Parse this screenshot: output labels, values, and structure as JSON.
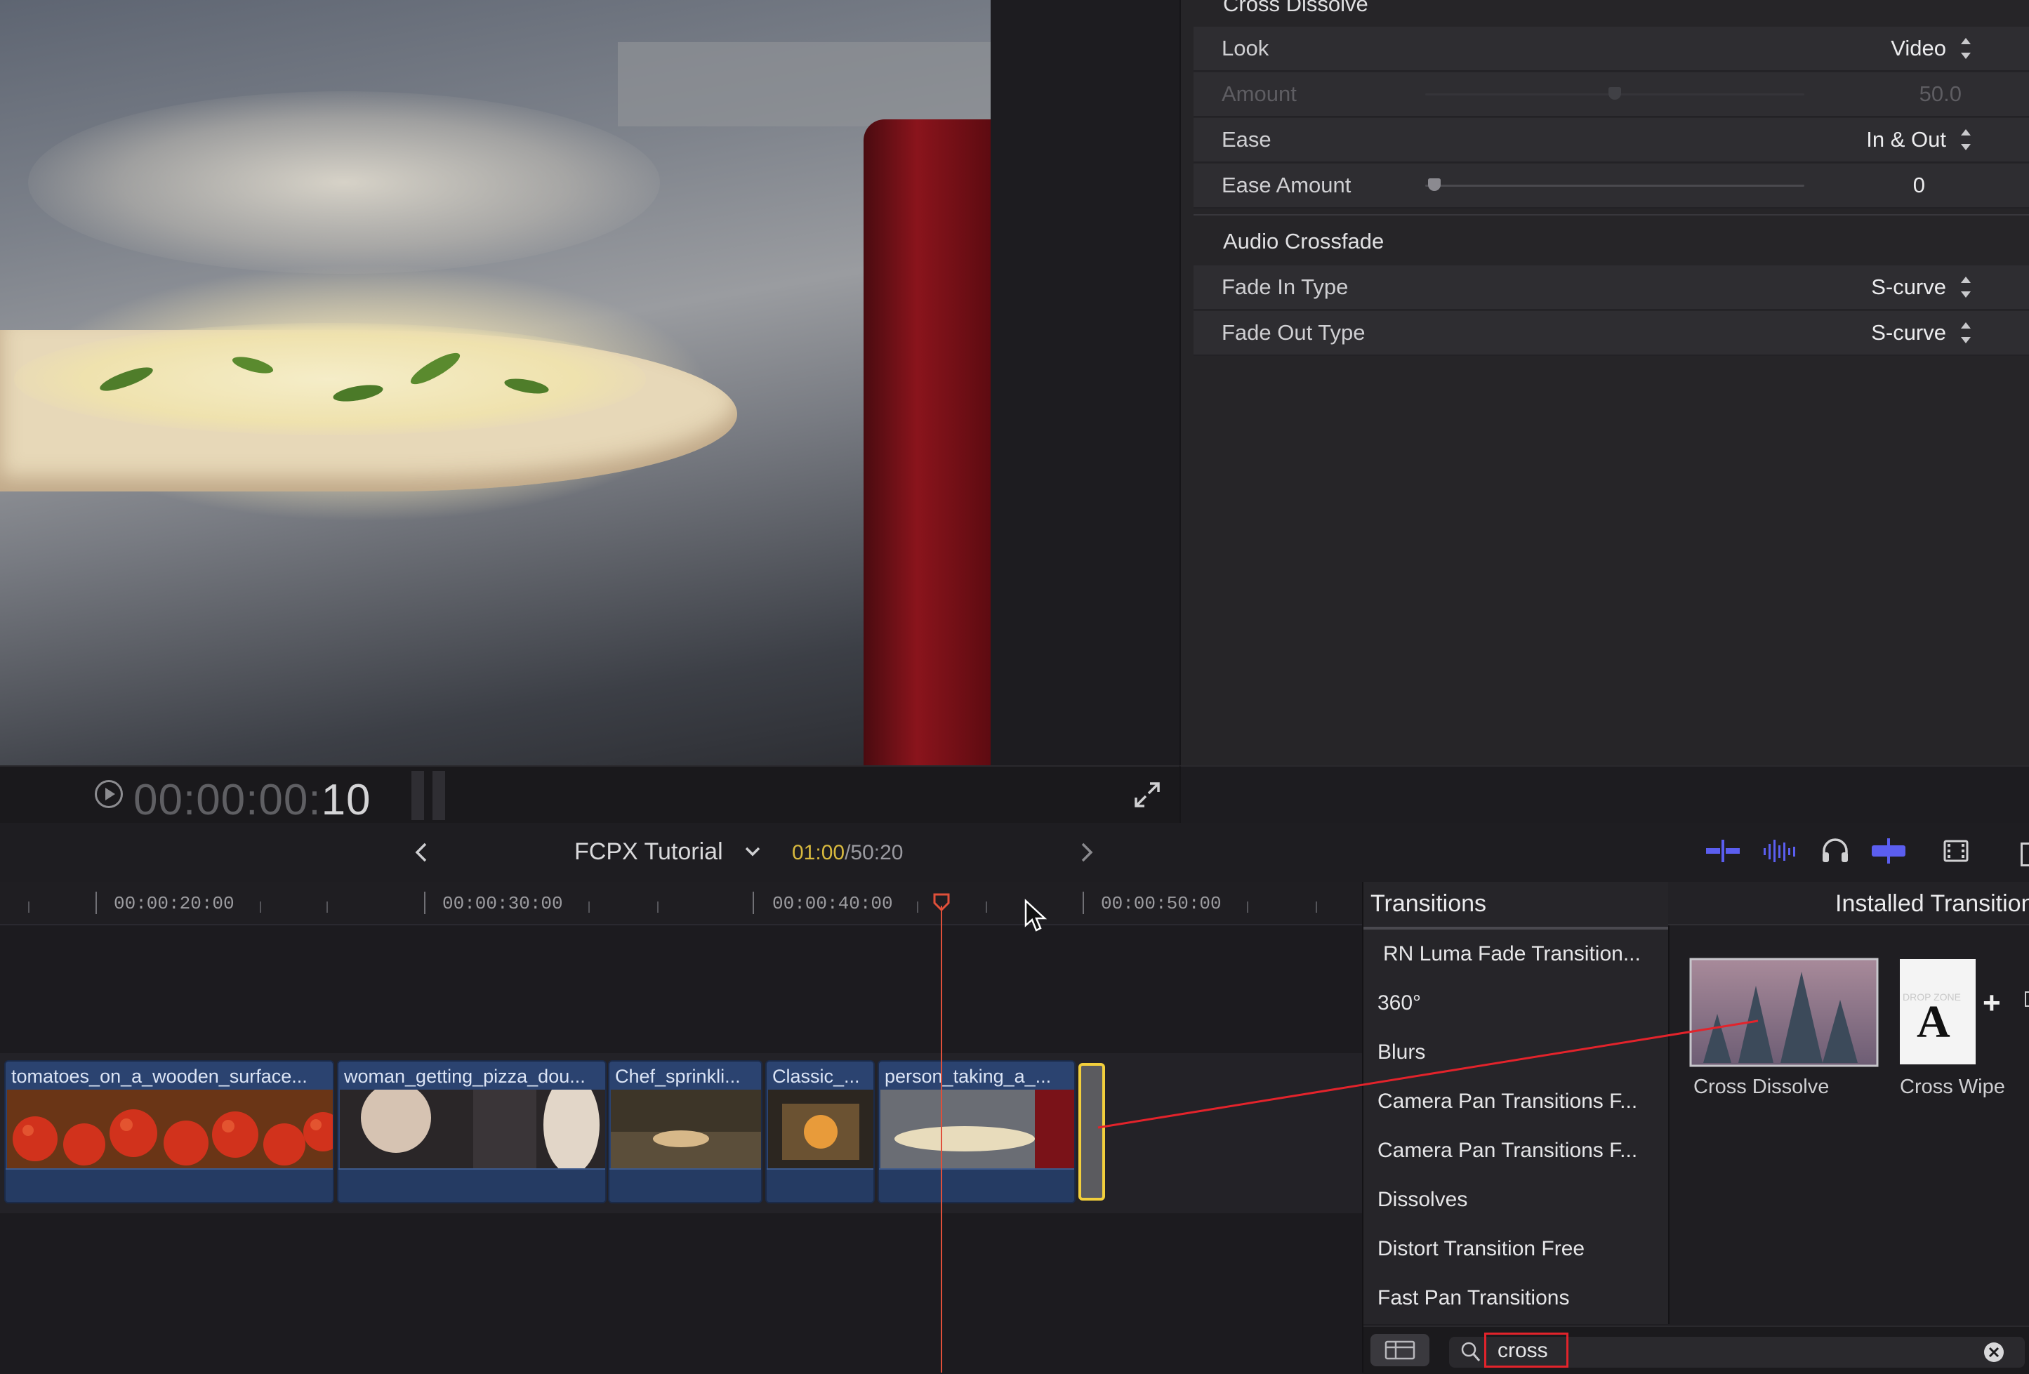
{
  "viewer": {
    "timecode_dim": "00:00:00:",
    "timecode_frames": "10"
  },
  "inspector": {
    "section_title": "Cross Dissolve",
    "rows": [
      {
        "label": "Look",
        "value": "Video"
      },
      {
        "label": "Amount",
        "value": "50.0"
      },
      {
        "label": "Ease",
        "value": "In & Out"
      },
      {
        "label": "Ease Amount",
        "value": "0"
      }
    ],
    "amount_level": 0.5,
    "ease_amount_level": 0.0,
    "audio_section": "Audio Crossfade",
    "audio_rows": [
      {
        "label": "Fade In Type",
        "value": "S-curve"
      },
      {
        "label": "Fade Out Type",
        "value": "S-curve"
      }
    ]
  },
  "timeline_header": {
    "project_name": "FCPX Tutorial",
    "current_time": "01:00",
    "separator": "/",
    "total_time": "50:20",
    "colors": {
      "current_time": "#d8b93e",
      "total_time": "#9a9aa0",
      "tool_active": "#5b5ef0"
    },
    "tools": [
      "snapping-icon",
      "audio-skimming-icon",
      "solo-icon",
      "skimming-icon",
      "clip-appearance-icon"
    ]
  },
  "ruler": {
    "labels": [
      "00:00:20:00",
      "00:00:30:00",
      "00:00:40:00",
      "00:00:50:00"
    ]
  },
  "clips": [
    {
      "name": "tomatoes_on_a_wooden_surface..."
    },
    {
      "name": "woman_getting_pizza_dou..."
    },
    {
      "name": "Chef_sprinkli..."
    },
    {
      "name": "Classic_..."
    },
    {
      "name": "person_taking_a_..."
    }
  ],
  "browser": {
    "categories_title": "Transitions",
    "categories": [
      "RN Luma Fade Transition...",
      "360°",
      "Blurs",
      "Camera Pan Transitions F...",
      "Camera Pan Transitions F...",
      "Dissolves",
      "Distort Transition Free",
      "Fast Pan Transitions"
    ],
    "installed_title": "Installed Transitions",
    "thumbnails": [
      {
        "label": "Cross Dissolve"
      },
      {
        "label": "Cross Wipe"
      }
    ],
    "cross_wipe_thumb_text": "A",
    "cross_wipe_thumb_small": "DROP ZONE",
    "search_value": "cross",
    "annotation_color": "#e3232b"
  }
}
